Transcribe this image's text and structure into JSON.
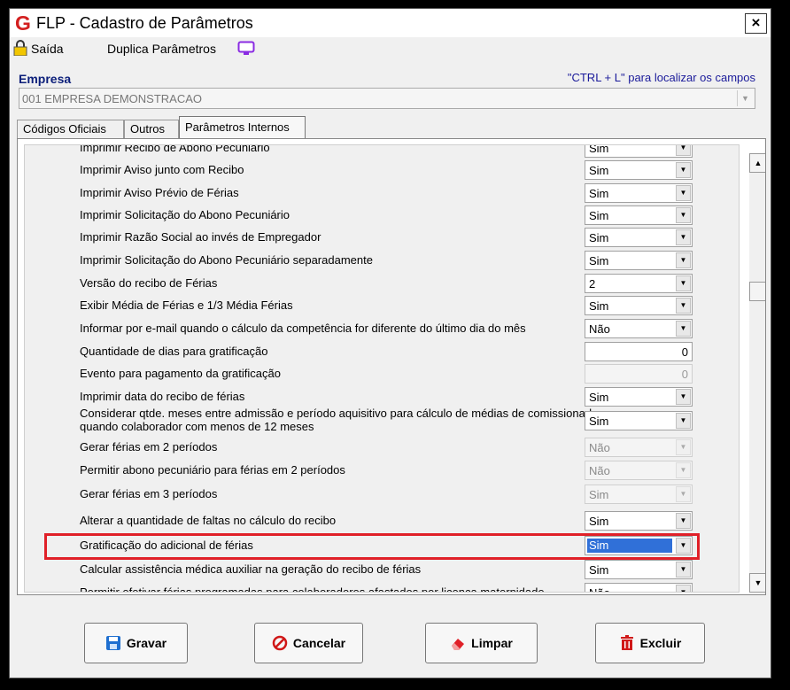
{
  "window": {
    "title": "FLP - Cadastro de Parâmetros",
    "close_label": "×"
  },
  "menu": {
    "saida": "Saída",
    "duplica": "Duplica Parâmetros"
  },
  "empresa": {
    "label": "Empresa",
    "hint": "\"CTRL + L\" para localizar os campos",
    "value": "001 EMPRESA DEMONSTRACAO"
  },
  "tabs": [
    {
      "label": "Códigos Oficiais",
      "active": false
    },
    {
      "label": "Outros",
      "active": false
    },
    {
      "label": "Parâmetros Internos",
      "active": true
    }
  ],
  "params": [
    {
      "label": "Imprimir Recibo de Abono Pecuniário",
      "value": "Sim",
      "type": "select",
      "disabled": false
    },
    {
      "label": "Imprimir Aviso junto com Recibo",
      "value": "Sim",
      "type": "select",
      "disabled": false
    },
    {
      "label": "Imprimir Aviso Prévio de Férias",
      "value": "Sim",
      "type": "select",
      "disabled": false
    },
    {
      "label": "Imprimir Solicitação do Abono Pecuniário",
      "value": "Sim",
      "type": "select",
      "disabled": false
    },
    {
      "label": "Imprimir Razão Social ao invés de Empregador",
      "value": "Sim",
      "type": "select",
      "disabled": false
    },
    {
      "label": "Imprimir Solicitação do Abono Pecuniário separadamente",
      "value": "Sim",
      "type": "select",
      "disabled": false
    },
    {
      "label": "Versão do recibo de Férias",
      "value": "2",
      "type": "select",
      "disabled": false
    },
    {
      "label": "Exibir Média de Férias e 1/3  Média Férias",
      "value": "Sim",
      "type": "select",
      "disabled": false
    },
    {
      "label": "Informar por e-mail quando o cálculo da competência for diferente do último dia do mês",
      "value": "Não",
      "type": "select",
      "disabled": false
    },
    {
      "label": "Quantidade de dias para gratificação",
      "value": "0",
      "type": "number",
      "disabled": false
    },
    {
      "label": "Evento para pagamento da gratificação",
      "value": "0",
      "type": "number",
      "disabled": true
    },
    {
      "label": "Imprimir data do recibo de férias",
      "value": "Sim",
      "type": "select",
      "disabled": false
    },
    {
      "label": "Considerar qtde. meses entre admissão e período aquisitivo para cálculo de médias de comissionados quando colaborador com menos de 12 meses",
      "value": "Sim",
      "type": "select",
      "disabled": false
    },
    {
      "label": "Gerar férias em 2 períodos",
      "value": "Não",
      "type": "select",
      "disabled": true
    },
    {
      "label": "Permitir abono pecuniário para férias em 2 períodos",
      "value": "Não",
      "type": "select",
      "disabled": true
    },
    {
      "label": "Gerar férias em 3 períodos",
      "value": "Sim",
      "type": "select",
      "disabled": true
    },
    {
      "label": "Alterar a quantidade de faltas no cálculo do recibo",
      "value": "Sim",
      "type": "select",
      "disabled": false
    },
    {
      "label": "Gratificação do adicional de férias",
      "value": "Sim",
      "type": "select",
      "disabled": false,
      "selected": true
    },
    {
      "label": "Calcular assistência médica auxiliar na geração do recibo de férias",
      "value": "Sim",
      "type": "select",
      "disabled": false
    },
    {
      "label": "Permitir efetivar férias programadas para colaboradores afastados por licença maternidade",
      "value": "Não",
      "type": "select",
      "disabled": false
    }
  ],
  "buttons": {
    "gravar": "Gravar",
    "cancelar": "Cancelar",
    "limpar": "Limpar",
    "excluir": "Excluir"
  },
  "colors": {
    "highlight": "#e02028",
    "empresa_label": "#0c1f7a",
    "hint": "#1a1a9a",
    "selection": "#3070d8"
  }
}
